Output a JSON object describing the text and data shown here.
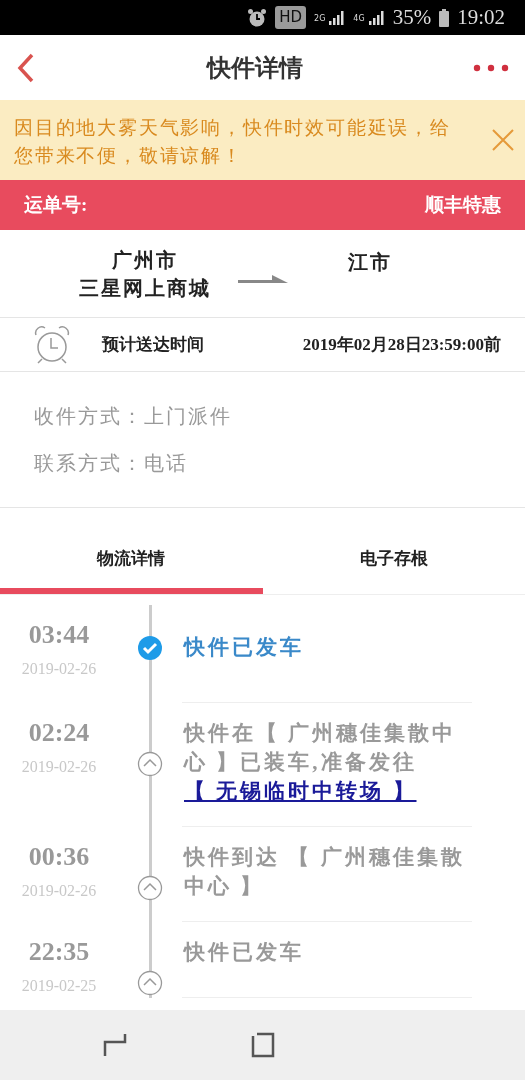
{
  "status_bar": {
    "hd": "HD",
    "network_1": "2G",
    "network_2": "4G",
    "battery": "35%",
    "time": "19:02"
  },
  "header": {
    "title": "快件详情"
  },
  "notice": {
    "text": "因目的地大雾天气影响，快件时效可能延误，给您带来不便，敬请谅解！"
  },
  "waybill": {
    "label": "运单号:",
    "service": "顺丰特惠"
  },
  "route": {
    "origin_city": "广州市",
    "origin_name": "三星网上商城",
    "destination_city": "江市"
  },
  "eta": {
    "label": "预计送达时间",
    "value": "2019年02月28日23:59:00前"
  },
  "info": [
    {
      "text": "收件方式：上门派件"
    },
    {
      "text": "联系方式：电话"
    }
  ],
  "tabs": [
    {
      "label": "物流详情",
      "selected": true
    },
    {
      "label": "电子存根",
      "selected": false
    }
  ],
  "timeline": [
    {
      "time": "03:44",
      "date": "2019-02-26",
      "text": "快件已发车",
      "kind": "current"
    },
    {
      "time": "02:24",
      "date": "2019-02-26",
      "text": "快件在【 广州穗佳集散中心 】已装车,准备发往 ",
      "link": "【 无锡临时中转场 】",
      "kind": "past"
    },
    {
      "time": "00:36",
      "date": "2019-02-26",
      "text": "快件到达 【 广州穗佳集散中心 】",
      "kind": "past"
    },
    {
      "time": "22:35",
      "date": "2019-02-25",
      "text": "快件已发车",
      "kind": "past"
    }
  ]
}
